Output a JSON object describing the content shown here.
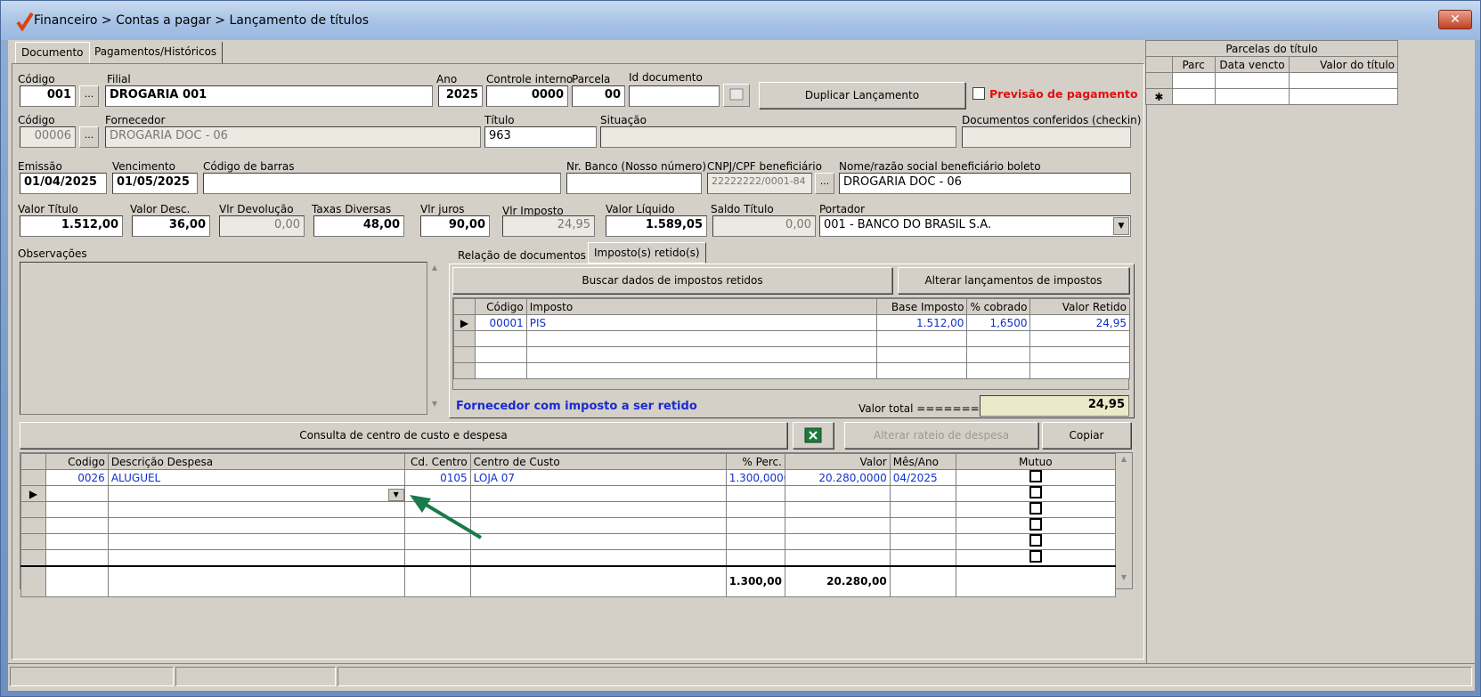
{
  "window": {
    "title": "Financeiro > Contas a pagar > Lançamento de títulos",
    "close": "✕"
  },
  "tabs": {
    "documento": "Documento",
    "pagamentos": "Pagamentos/Históricos"
  },
  "form": {
    "codigo_label": "Código",
    "codigo_value": "001",
    "filial_label": "Filial",
    "filial_value": "DROGARIA 001",
    "ano_label": "Ano",
    "ano_value": "2025",
    "controle_label": "Controle interno",
    "controle_value": "0000",
    "parcela_label": "Parcela",
    "parcela_value": "00",
    "iddoc_label": "Id documento",
    "iddoc_value": "",
    "duplicar_button": "Duplicar Lançamento",
    "previsao_label": "Previsão de pagamento",
    "codigo2_label": "Código",
    "codigo2_value": "00006",
    "fornecedor_label": "Fornecedor",
    "fornecedor_value": "DROGARIA DOC - 06",
    "titulo_label": "Título",
    "titulo_value": "963",
    "situacao_label": "Situação",
    "situacao_value": "",
    "docs_conf_label": "Documentos conferidos (checkin)",
    "docs_conf_value": "",
    "emissao_label": "Emissão",
    "emissao_value": "01/04/2025",
    "vencimento_label": "Vencimento",
    "vencimento_value": "01/05/2025",
    "codbarras_label": "Código de barras",
    "codbarras_value": "",
    "nrbanco_label": "Nr. Banco (Nosso número)",
    "nrbanco_value": "",
    "cnpj_label": "CNPJ/CPF beneficiário",
    "cnpj_value": "22222222/0001-84",
    "nome_label": "Nome/razão social beneficiário boleto",
    "nome_value": "DROGARIA DOC - 06",
    "valor_titulo_label": "Valor Título",
    "valor_titulo_value": "1.512,00",
    "valor_desc_label": "Valor Desc.",
    "valor_desc_value": "36,00",
    "vlr_devol_label": "Vlr Devolução",
    "vlr_devol_value": "0,00",
    "taxas_label": "Taxas Diversas",
    "taxas_value": "48,00",
    "juros_label": "Vlr juros",
    "juros_value": "90,00",
    "imposto_label": "Vlr Imposto",
    "imposto_value": "24,95",
    "liquido_label": "Valor Líquido",
    "liquido_value": "1.589,05",
    "saldo_label": "Saldo Título",
    "saldo_value": "0,00",
    "portador_label": "Portador",
    "portador_value": "001 - BANCO DO BRASIL S.A.",
    "obs_label": "Observações"
  },
  "impostos": {
    "tab_relacao": "Relação de documentos",
    "tab_retidos": "Imposto(s) retido(s)",
    "buscar_button": "Buscar dados de impostos retidos",
    "alterar_button": "Alterar lançamentos de impostos",
    "headers": [
      "Código",
      "Imposto",
      "Base Imposto",
      "% cobrado",
      "Valor Retido"
    ],
    "rows": [
      [
        "00001",
        "PIS",
        "1.512,00",
        "1,6500",
        "24,95"
      ]
    ],
    "fornecedor_msg": "Fornecedor com imposto a ser retido",
    "valor_total_label": "Valor total ==========>",
    "valor_total_value": "24,95"
  },
  "centro": {
    "consulta_button": "Consulta de centro de custo e despesa",
    "alterar_rateio_button": "Alterar rateio de despesa",
    "copiar_button": "Copiar",
    "headers": [
      "Codigo",
      "Descrição Despesa",
      "Cd. Centro",
      "Centro de Custo",
      "% Perc.",
      "Valor",
      "Mês/Ano",
      "Mutuo"
    ],
    "rows": [
      [
        "0026",
        "ALUGUEL",
        "0105",
        "LOJA 07",
        "1.300,0000",
        "20.280,0000",
        "04/2025",
        ""
      ]
    ],
    "total_perc": "1.300,00",
    "total_valor": "20.280,00"
  },
  "parcelas": {
    "title": "Parcelas do título",
    "headers": [
      "Parc",
      "Data vencto",
      "Valor do título"
    ]
  }
}
